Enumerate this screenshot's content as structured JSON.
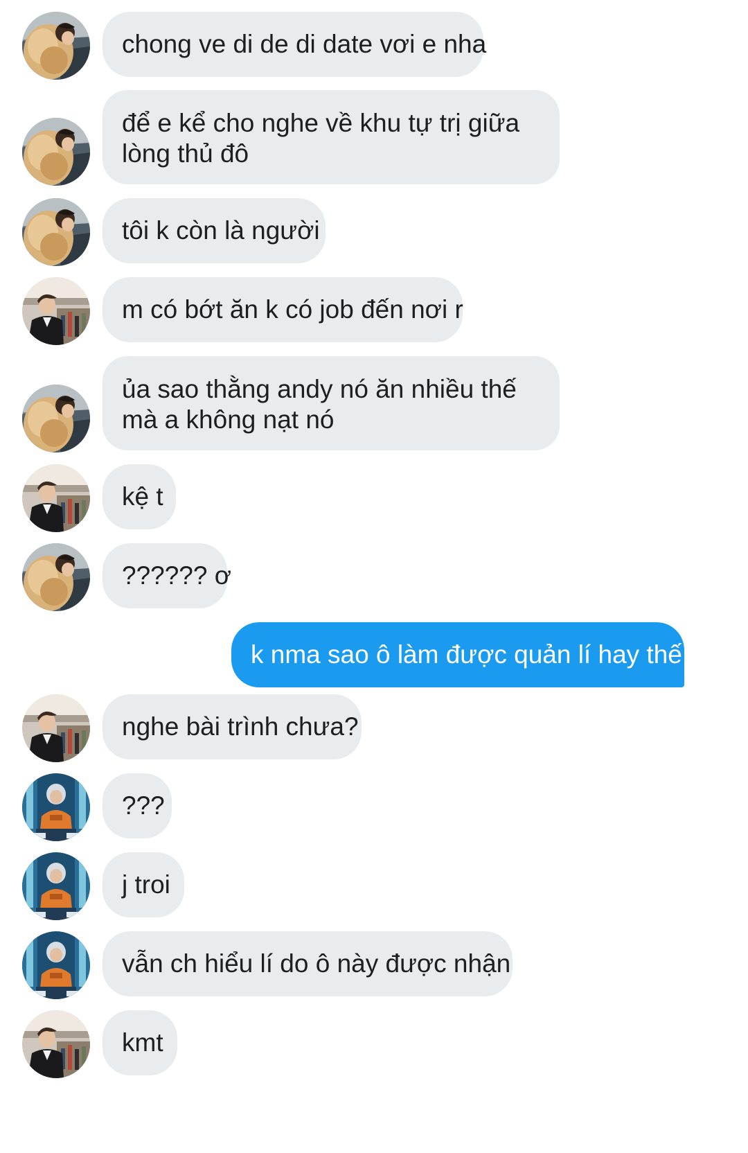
{
  "conversation": {
    "avatar_kinds": {
      "a": "fluffy-hoodie-person-avatar",
      "b": "suit-man-in-crowd-avatar",
      "c": "orange-jersey-person-avatar"
    },
    "messages": [
      {
        "sender": "a",
        "direction": "incoming",
        "text": "chong ve di de di date vơi e nha"
      },
      {
        "sender": "a",
        "direction": "incoming",
        "line1": "để e kể cho nghe về khu tự trị giữa",
        "line2": "lòng thủ đô"
      },
      {
        "sender": "a",
        "direction": "incoming",
        "text": "tôi k còn là người"
      },
      {
        "sender": "b",
        "direction": "incoming",
        "text": "m có bớt ăn k có job đến nơi r"
      },
      {
        "sender": "a",
        "direction": "incoming",
        "line1": "ủa sao thằng andy nó ăn nhiều thế",
        "line2": "mà a không nạt nó"
      },
      {
        "sender": "b",
        "direction": "incoming",
        "text": "kệ t"
      },
      {
        "sender": "a",
        "direction": "incoming",
        "text": "?????? ơ"
      },
      {
        "sender": "me",
        "direction": "outgoing",
        "text": "k nma sao ô làm được quản lí hay thế"
      },
      {
        "sender": "b",
        "direction": "incoming",
        "text": "nghe bài trình chưa?"
      },
      {
        "sender": "c",
        "direction": "incoming",
        "text": "???"
      },
      {
        "sender": "c",
        "direction": "incoming",
        "text": "j troi"
      },
      {
        "sender": "c",
        "direction": "incoming",
        "text": "vẫn ch hiểu lí do ô này được nhận"
      },
      {
        "sender": "b",
        "direction": "incoming",
        "text": "kmt"
      }
    ]
  },
  "colors": {
    "incoming_bubble": "#e9ecef",
    "outgoing_bubble": "#1a9bf0",
    "incoming_text": "#1c1e21",
    "outgoing_text": "#ffffff"
  }
}
